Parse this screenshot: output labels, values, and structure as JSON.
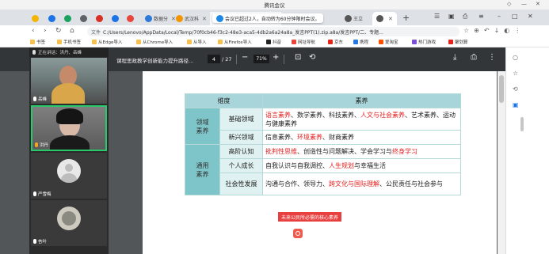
{
  "meeting_window": {
    "title": "腾讯会议"
  },
  "tabs": [
    {
      "label": "数据分",
      "color": "#2e7ad8"
    },
    {
      "label": "武汉科",
      "color": "#f29500"
    },
    {
      "label": "会议已超过2人，自动转为60分钟限时会议。",
      "color": "#1e88e5",
      "active": true
    },
    {
      "label": "王立",
      "color": "#555555"
    },
    {
      "label": "",
      "color": "#555555"
    }
  ],
  "toolbar": {
    "url_prefix": "文件",
    "url": "C:/Users/Lenovo/AppData/Local/Temp/70f0cb46-f3c2-48e3-aca5-4db2a6a24a8a_发言PPT(1).zip.a8a/发言PPT/二、专题..."
  },
  "bookmarks": [
    "书签",
    "手机书签",
    "从Edge导入",
    "从Chrome导入",
    "从导入",
    "从Firefox导入",
    "抖音",
    "网址导航",
    "京东",
    "携程",
    "爱淘宝",
    "热门游戏",
    "聚划算"
  ],
  "meeting": {
    "status": "正在讲话：洪丹、岳峰",
    "participants": [
      {
        "name": "岳峰",
        "kind": "video"
      },
      {
        "name": "洪丹",
        "kind": "video",
        "speaking": true
      },
      {
        "name": "严雪梅",
        "kind": "avatar"
      },
      {
        "name": "杏叶",
        "kind": "photo"
      }
    ]
  },
  "pdf": {
    "title": "课程思政教学创新能力提升路径...",
    "page": "4",
    "total_pages": "/ 27",
    "zoom": "71%"
  },
  "table": {
    "header_dim": "维度",
    "header_content": "素养",
    "groups": [
      {
        "label": "领域素养",
        "rows": [
          {
            "sub": "基础领域",
            "segments": [
              {
                "text": "语言素养",
                "red": true
              },
              {
                "text": "、数学素养、科技素养、"
              },
              {
                "text": "人文与社会素养",
                "red": true
              },
              {
                "text": "、艺术素养、运动与健康素养"
              }
            ]
          },
          {
            "sub": "新兴领域",
            "segments": [
              {
                "text": "信息素养、"
              },
              {
                "text": "环境素养",
                "red": true
              },
              {
                "text": "、财商素养"
              }
            ]
          }
        ]
      },
      {
        "label": "通用素养",
        "rows": [
          {
            "sub": "高阶认知",
            "segments": [
              {
                "text": "批判性思维",
                "red": true
              },
              {
                "text": "、创造性与问题解决、学会学习与"
              },
              {
                "text": "终身学习",
                "red": true
              }
            ]
          },
          {
            "sub": "个人成长",
            "segments": [
              {
                "text": "自我认识与自我调控、"
              },
              {
                "text": "人生规划",
                "red": true
              },
              {
                "text": "与幸福生活"
              }
            ]
          },
          {
            "sub": "社会性发展",
            "segments": [
              {
                "text": "沟通与合作、领导力、"
              },
              {
                "text": "跨文化与国际理解",
                "red": true
              },
              {
                "text": "、公民责任与社会参与"
              }
            ]
          }
        ]
      }
    ],
    "caption": "未来公民所必需的核心素养"
  },
  "colors": {
    "accent_red": "#e02222",
    "table_header": "#a7d5da",
    "table_group": "#7ec5c9",
    "speaking_border": "#29c96b"
  }
}
